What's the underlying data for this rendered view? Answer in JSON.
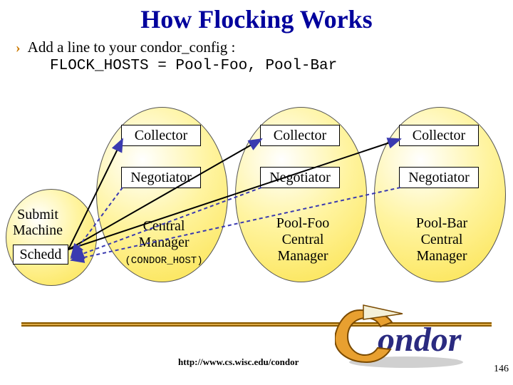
{
  "title": "How Flocking Works",
  "bullet": "Add a line to your condor_config :",
  "code": "FLOCK_HOSTS = Pool-Foo, Pool-Bar",
  "cards": {
    "collector": "Collector",
    "negotiator": "Negotiator",
    "schedd": "Schedd"
  },
  "submit_label": "Submit\nMachine",
  "pools": {
    "central": "Central\nManager",
    "central_host": "(CONDOR_HOST)",
    "foo": "Pool-Foo\nCentral\nManager",
    "bar": "Pool-Bar\nCentral\nManager"
  },
  "footer": {
    "url": "http://www.cs.wisc.edu/condor",
    "page": "146"
  },
  "logo_text": "ondor"
}
